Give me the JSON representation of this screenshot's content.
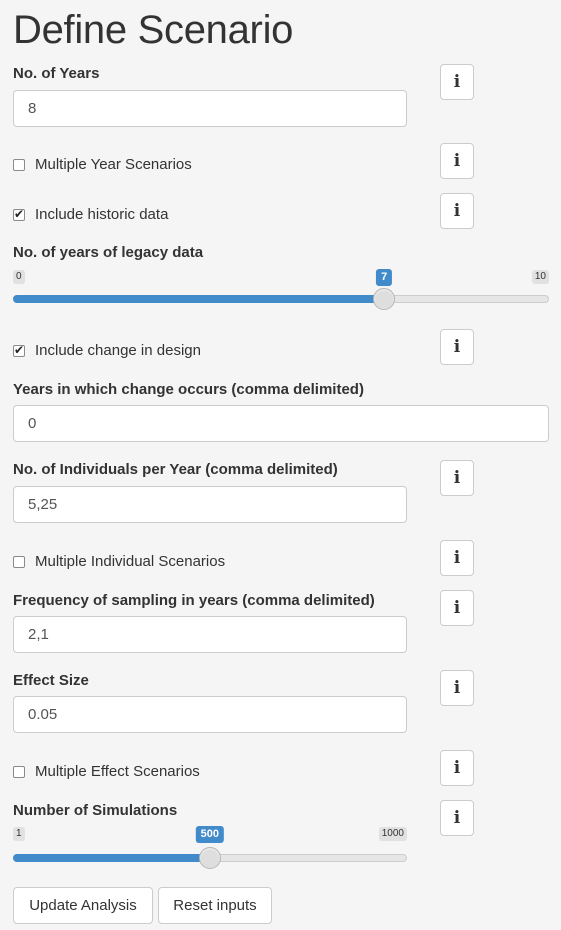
{
  "title": "Define Scenario",
  "years": {
    "label": "No. of Years",
    "value": "8"
  },
  "multi_year": {
    "label": "Multiple Year Scenarios",
    "checked": false
  },
  "historic": {
    "label": "Include historic data",
    "checked": true
  },
  "legacy": {
    "label": "No. of years of legacy data",
    "min": "0",
    "max": "10",
    "value": "7",
    "min_num": 0,
    "max_num": 10,
    "value_num": 7
  },
  "change_design": {
    "label": "Include change in design",
    "checked": true
  },
  "change_years": {
    "label": "Years in which change occurs (comma delimited)",
    "value": "0"
  },
  "individuals": {
    "label": "No. of Individuals per Year (comma delimited)",
    "value": "5,25"
  },
  "multi_indiv": {
    "label": "Multiple Individual Scenarios",
    "checked": false
  },
  "frequency": {
    "label": "Frequency of sampling in years (comma delimited)",
    "value": "2,1"
  },
  "effect": {
    "label": "Effect Size",
    "value": "0.05"
  },
  "multi_effect": {
    "label": "Multiple Effect Scenarios",
    "checked": false
  },
  "simulations": {
    "label": "Number of Simulations",
    "min": "1",
    "max": "1000",
    "value": "500",
    "min_num": 1,
    "max_num": 1000,
    "value_num": 500
  },
  "buttons": {
    "update": "Update Analysis",
    "reset": "Reset inputs"
  },
  "info_glyph": "i",
  "colors": {
    "accent": "#428bca",
    "background": "#f5f5f5"
  }
}
